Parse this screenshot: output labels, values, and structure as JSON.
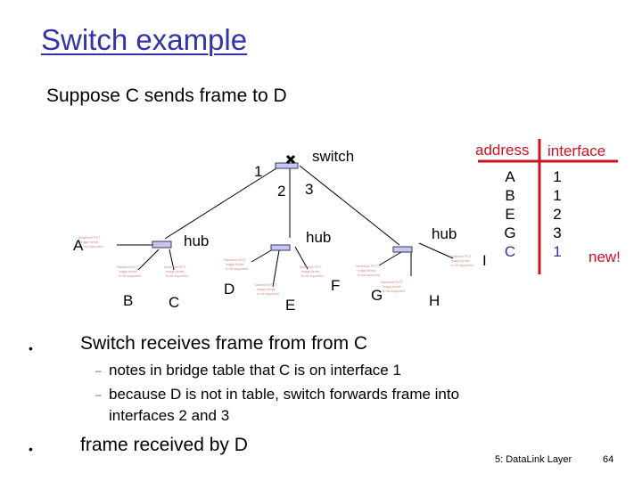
{
  "slide": {
    "title": "Switch example",
    "subtitle": "Suppose C sends frame to D"
  },
  "diagram": {
    "switch_label": "switch",
    "switch_icon": "x-mark",
    "interfaces": [
      "1",
      "2",
      "3"
    ],
    "hub_label": "hub",
    "hubs": [
      "hub",
      "hub",
      "hub"
    ],
    "hosts": [
      "A",
      "B",
      "C",
      "D",
      "E",
      "F",
      "G",
      "H",
      "I"
    ],
    "placeholder_text": [
      "Macintosh PICT",
      "image format",
      "is not supported"
    ]
  },
  "table": {
    "headers": [
      "address",
      "interface"
    ],
    "rows": [
      {
        "address": "A",
        "interface": "1",
        "new": false
      },
      {
        "address": "B",
        "interface": "1",
        "new": false
      },
      {
        "address": "E",
        "interface": "2",
        "new": false
      },
      {
        "address": "G",
        "interface": "3",
        "new": false
      },
      {
        "address": "C",
        "interface": "1",
        "new": true
      }
    ],
    "new_label": "new!",
    "header_color": "#cc1122",
    "new_row_color": "#333399"
  },
  "bullets": [
    {
      "text": "Switch receives frame from from C",
      "sub": [
        "notes in bridge table that C is on interface 1",
        "because D is not in table, switch forwards frame into",
        "interfaces 2 and 3"
      ]
    },
    {
      "text": "frame received by D",
      "sub": []
    }
  ],
  "footer": {
    "section": "5: DataLink Layer",
    "page": "64"
  }
}
